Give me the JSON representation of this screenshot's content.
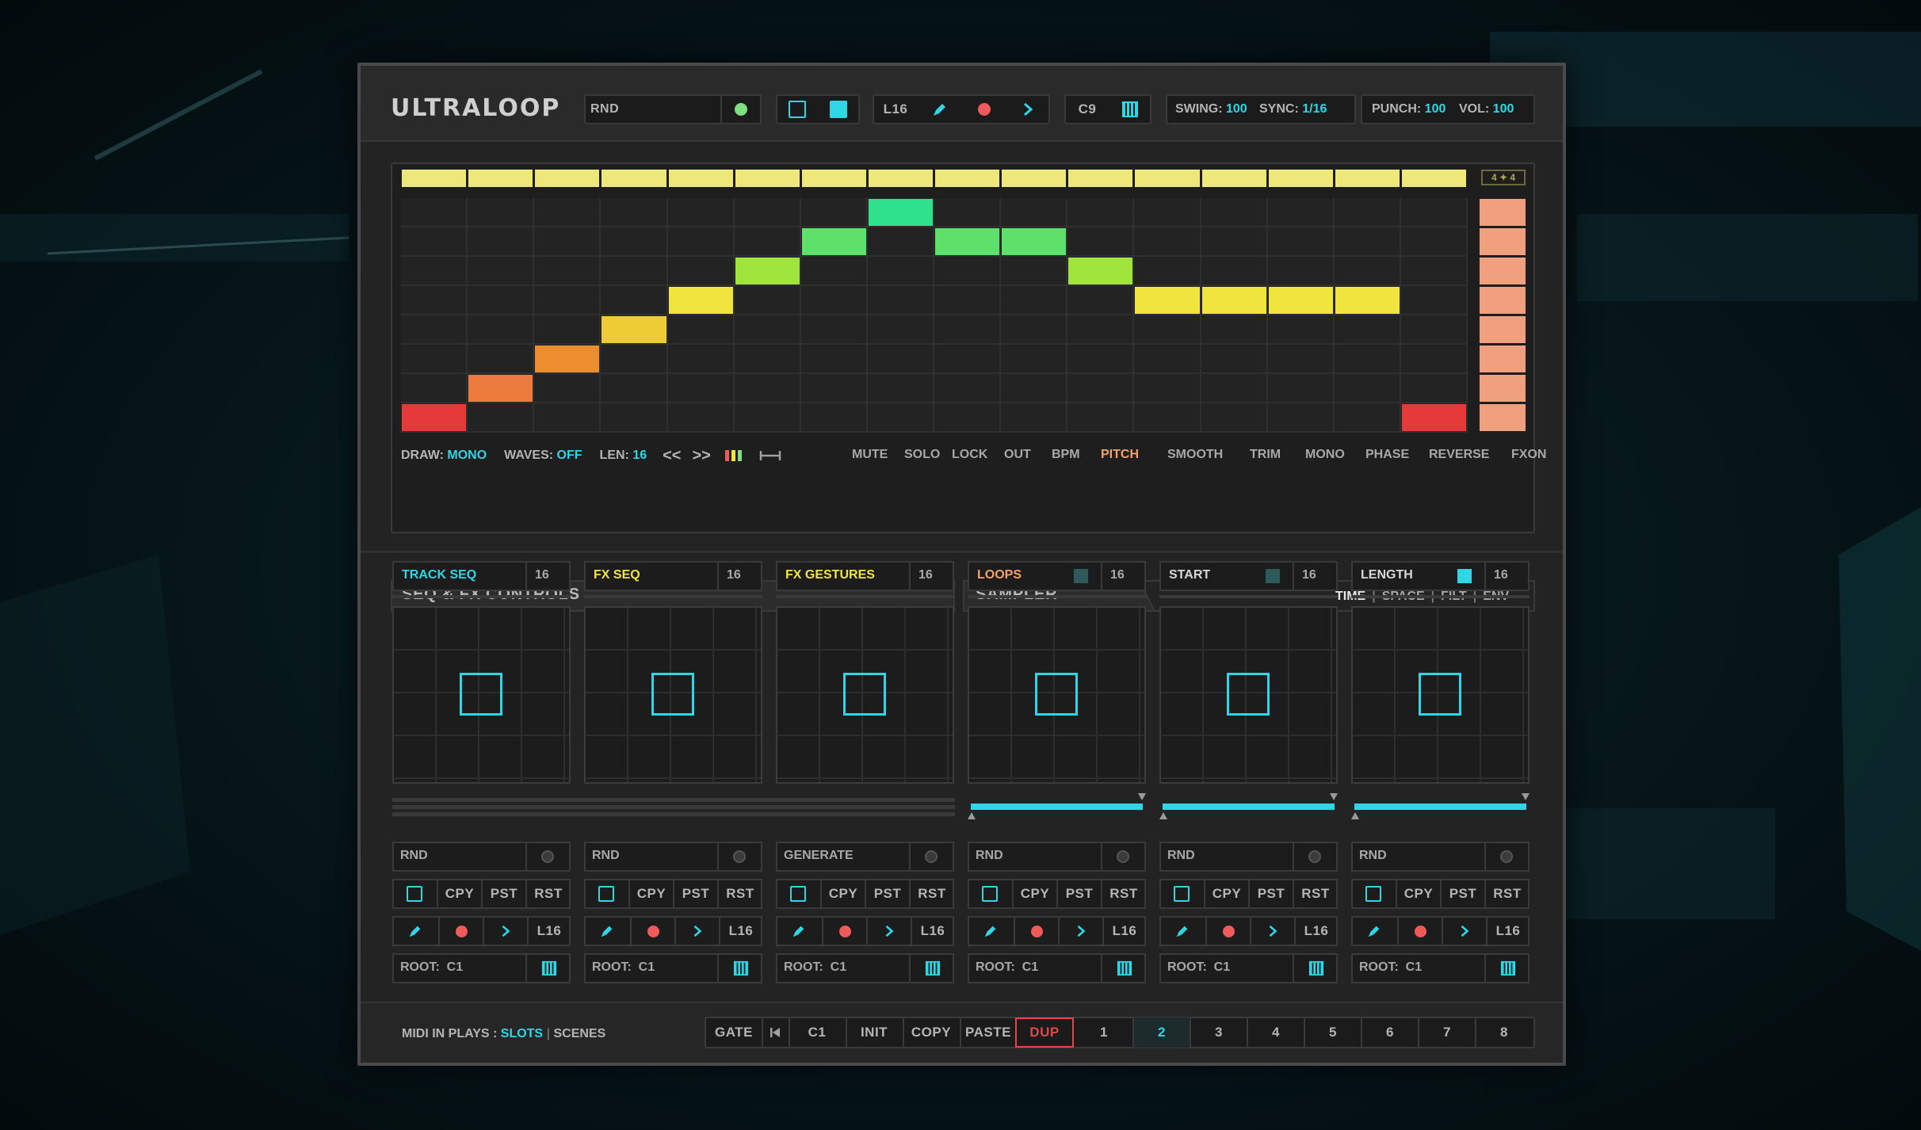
{
  "app": {
    "title": "ULTRALOOP"
  },
  "toolbar": {
    "preset": "RND",
    "length": "L16",
    "root": "C9",
    "swing_label": "SWING:",
    "swing_value": "100",
    "sync_label": "SYNC:",
    "sync_value": "1/16",
    "punch_label": "PUNCH:",
    "punch_value": "100",
    "vol_label": "VOL:",
    "vol_value": "100"
  },
  "colors": {
    "accent": "#2fd6e6",
    "pitch_active": "#f5a26a",
    "dup_active": "#e04848",
    "record": "#ef5b5b",
    "go": "#7ee07e"
  },
  "sequencer": {
    "steps": 16,
    "rows": 8,
    "values": [
      1,
      2,
      3,
      4,
      5,
      6,
      7,
      8,
      7,
      7,
      6,
      5,
      5,
      5,
      5,
      1
    ],
    "step_colors": [
      "#e43a3a",
      "#ee7b3e",
      "#ec8e2f",
      "#edcc35",
      "#f0e53e",
      "#9fe53d",
      "#5ee16b",
      "#2fe08d",
      "#5ee16b",
      "#5ee16b",
      "#9fe53d",
      "#f0e53e",
      "#f0e53e",
      "#f0e53e",
      "#f0e53e",
      "#e43a3a"
    ],
    "side_label": "4 ✦ 4"
  },
  "seq_footer": {
    "draw_label": "DRAW:",
    "draw_value": "MONO",
    "waves_label": "WAVES:",
    "waves_value": "OFF",
    "len_label": "LEN:",
    "len_value": "16",
    "prev": "<<",
    "next": ">>",
    "tabs": [
      "MUTE",
      "SOLO",
      "LOCK",
      "OUT",
      "BPM",
      "PITCH",
      "SMOOTH",
      "TRIM",
      "MONO",
      "PHASE",
      "REVERSE",
      "FXON"
    ],
    "active_tab": "PITCH"
  },
  "sections": {
    "seq_fx": "SEQ & FX CONTROLS",
    "sampler": "SAMPLER",
    "sampler_tabs": [
      "TIME",
      "SPACE",
      "FILT",
      "ENV"
    ],
    "sampler_sep": "|"
  },
  "modules": [
    {
      "name": "TRACK SEQ",
      "count": "16",
      "name_color": "#2fd6e6",
      "mode": "RND",
      "root": "ROOT:  C1"
    },
    {
      "name": "FX SEQ",
      "count": "16",
      "name_color": "#f0e53e",
      "mode": "RND",
      "root": "ROOT:  C1"
    },
    {
      "name": "FX GESTURES",
      "count": "16",
      "name_color": "#f0e53e",
      "mode": "GENERATE",
      "root": "ROOT:  C1"
    },
    {
      "name": "LOOPS",
      "count": "16",
      "name_color": "#f5a26a",
      "mode": "RND",
      "root": "ROOT:  C1"
    },
    {
      "name": "START",
      "count": "16",
      "name_color": "#d8d8d8",
      "mode": "RND",
      "root": "ROOT:  C1"
    },
    {
      "name": "LENGTH",
      "count": "16",
      "name_color": "#d8d8d8",
      "mode": "RND",
      "root": "ROOT:  C1"
    }
  ],
  "edit_buttons": {
    "copy": "CPY",
    "paste": "PST",
    "reset": "RST",
    "length": "L16"
  },
  "footer": {
    "midi_label": "MIDI IN PLAYS :",
    "slots": "SLOTS",
    "sep": "|",
    "scenes": "SCENES",
    "gate": "GATE",
    "note": "C1",
    "init": "INIT",
    "copy": "COPY",
    "paste": "PASTE",
    "dup": "DUP",
    "slots_nums": [
      "1",
      "2",
      "3",
      "4",
      "5",
      "6",
      "7",
      "8"
    ],
    "active_slot": "2"
  }
}
